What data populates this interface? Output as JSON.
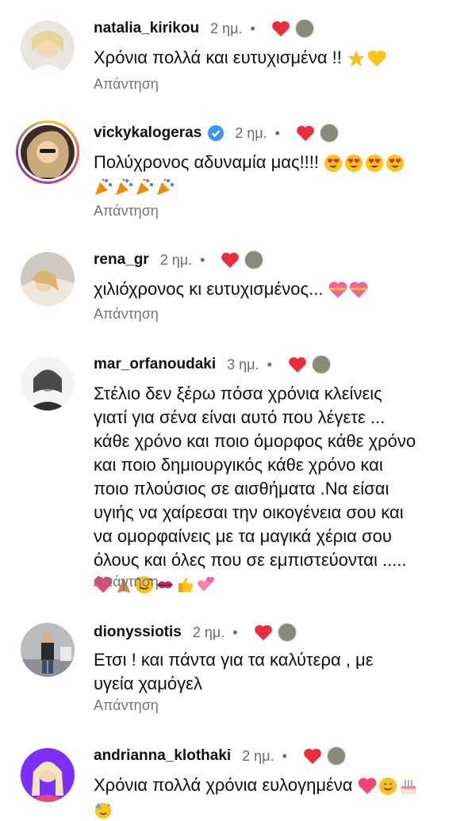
{
  "reply_label": "Απάντηση",
  "colors": {
    "heart": "#ed2b3a",
    "verified": "#3897f0",
    "muted": "#757575"
  },
  "comments": [
    {
      "username": "natalia_kirikou",
      "time": "2 ημ.",
      "dot": "•",
      "text": "Χρόνια πολλά και ευτυχισμένα !!",
      "emojis": [
        "star",
        "yellow-heart"
      ]
    },
    {
      "username": "vickykalogeras",
      "verified": true,
      "time": "2 ημ.",
      "dot": "•",
      "text": "Πολύχρονος αδυναμία μας!!!!",
      "emojis": [
        "heart-eyes",
        "heart-eyes",
        "heart-eyes",
        "heart-eyes",
        "party-popper",
        "party-popper",
        "party-popper",
        "party-popper"
      ]
    },
    {
      "username": "rena_gr",
      "time": "2 ημ.",
      "dot": "•",
      "text": "χιλιόχρονος κι ευτυχισμένος...",
      "emojis": [
        "heart-ribbon",
        "heart-ribbon"
      ]
    },
    {
      "username": "mar_orfanoudaki",
      "time": "3 ημ.",
      "dot": "•",
      "text_lines": [
        "Στέλιο δεν ξέρω πόσα χρόνια κλείνεις",
        "γιατί για σένα είναι αυτό που λέγετε ...",
        "κάθε χρόνο και ποιο όμορφος κάθε χρόνο",
        "και ποιο δημιουργικός κάθε χρόνο και",
        "ποιο πλούσιος σε αισθήματα .Να είσαι",
        "υγιής να χαίρεσαι την οικογένεια σου και",
        "να ομορφαίνεις με τα μαγικά χέρια σου",
        "όλους και όλες που σε εμπιστεύονται ....."
      ],
      "emojis": [
        "red-heart",
        "folded-hands",
        "smiling-hearts",
        "kiss-mark",
        "thumbs-up",
        "two-hearts"
      ]
    },
    {
      "username": "dionyssiotis",
      "time": "2 ημ.",
      "dot": "•",
      "text_lines": [
        "Ετσι ! και πάντα για τα καλύτερα , με",
        "υγεία χαμόγελ"
      ]
    },
    {
      "username": "andrianna_klothaki",
      "time": "2 ημ.",
      "dot": "•",
      "text": "Χρόνια πολλά χρόνια ευλογημένα",
      "emojis": [
        "pink-heart",
        "smiling-face",
        "birthday-cake",
        "partying-face"
      ]
    }
  ]
}
